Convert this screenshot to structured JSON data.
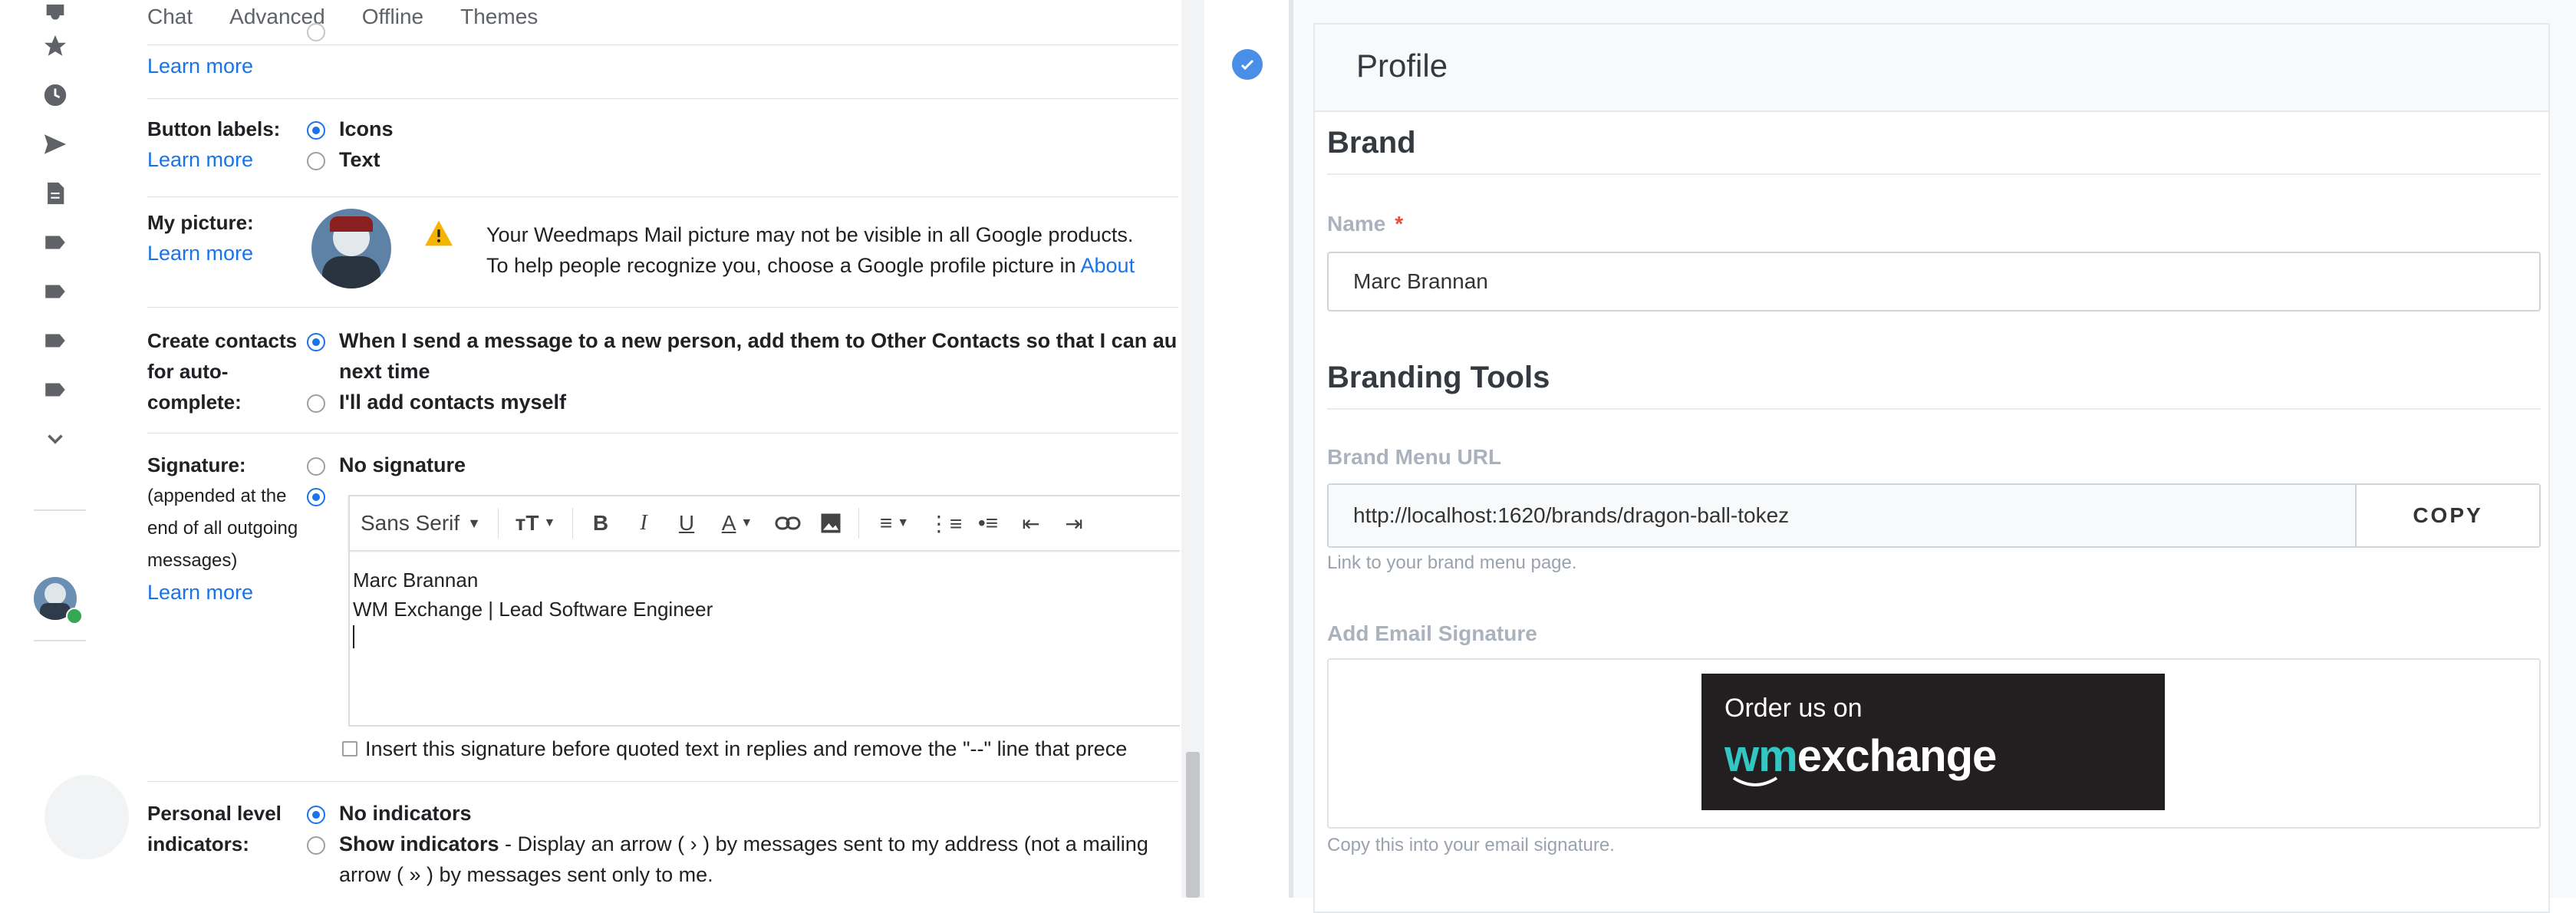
{
  "gmail": {
    "tabs": [
      "Chat",
      "Advanced",
      "Offline",
      "Themes"
    ],
    "learn_more": "Learn more",
    "button_labels": {
      "label": "Button labels:",
      "options": [
        "Icons",
        "Text"
      ],
      "selected": "Icons"
    },
    "my_picture": {
      "label": "My picture:",
      "warning_line1": "Your Weedmaps Mail picture may not be visible in all Google products.",
      "warning_line2": "To help people recognize you, choose a Google profile picture in",
      "about_link": "About"
    },
    "create_contacts": {
      "label_line1": "Create contacts",
      "label_line2": "for auto-",
      "label_line3": "complete:",
      "option1_line1": "When I send a message to a new person, add them to Other Contacts so that I can au",
      "option1_line2": "next time",
      "option2": "I'll add contacts myself"
    },
    "signature": {
      "label": "Signature:",
      "sub_line1": "(appended at the",
      "sub_line2": "end of all outgoing",
      "sub_line3": "messages)",
      "no_signature": "No signature",
      "font": "Sans Serif",
      "line1": "Marc Brannan",
      "line2": "WM Exchange | Lead Software Engineer",
      "insert_before_quoted": "Insert this signature before quoted text in replies and remove the \"--\" line that prece"
    },
    "personal_level": {
      "label_line1": "Personal level",
      "label_line2": "indicators:",
      "no_indicators": "No indicators",
      "show_indicators": "Show indicators",
      "show_desc": " - Display an arrow ( › ) by messages sent to my address (not a mailing",
      "show_desc2": "arrow ( » ) by messages sent only to me."
    }
  },
  "profile": {
    "header": "Profile",
    "brand_section": "Brand",
    "name_label": "Name",
    "required_mark": "*",
    "name_value": "Marc Brannan",
    "branding_tools": "Branding Tools",
    "menu_url_label": "Brand Menu URL",
    "menu_url_value": "http://localhost:1620/brands/dragon-ball-tokez",
    "copy_button": "COPY",
    "menu_url_help": "Link to your brand menu page.",
    "email_sig_label": "Add Email Signature",
    "email_sig_help": "Copy this into your email signature.",
    "logo_order": "Order us on",
    "logo_wm": "wm",
    "logo_exchange": "exchange"
  },
  "colors": {
    "gmail_blue": "#1a73e8",
    "warning": "#f4b400",
    "presence": "#34a853",
    "wm_teal": "#33c7c3",
    "logo_bg": "#231f20"
  }
}
